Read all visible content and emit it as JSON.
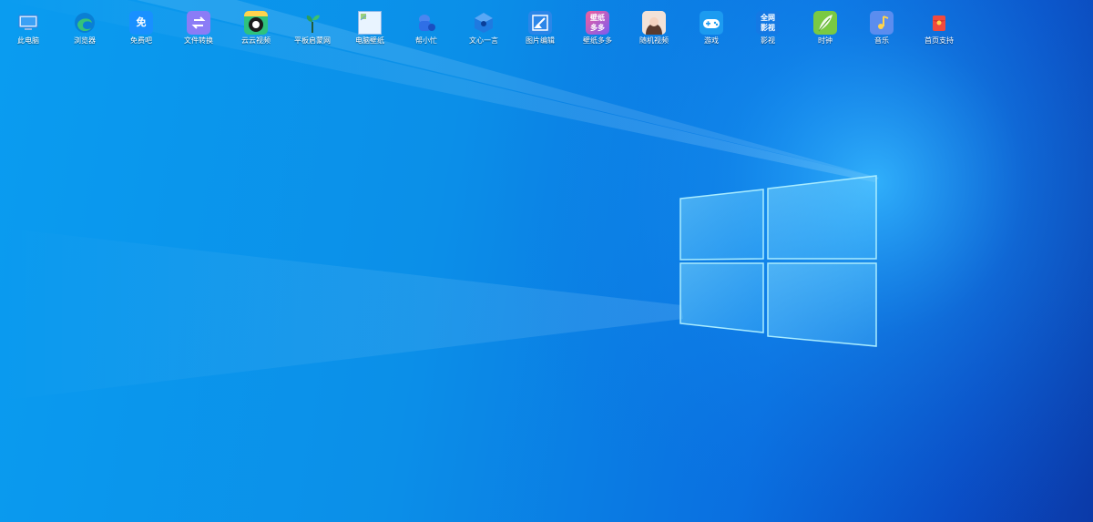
{
  "desktop": {
    "icons": [
      {
        "label": "此电脑",
        "icon": "computer-icon",
        "color": "#1e88e5"
      },
      {
        "label": "浏览器",
        "icon": "edge-browser-icon",
        "color": "#0a7fd4"
      },
      {
        "label": "免费吧",
        "icon": "free-app-icon",
        "color": "#1890ff",
        "glyph_text": "免"
      },
      {
        "label": "文件转换",
        "icon": "file-convert-icon",
        "color": "#8b7cf6"
      },
      {
        "label": "云云视频",
        "icon": "video-icon",
        "color": "#2ec27e"
      },
      {
        "label": "平板启蒙网",
        "icon": "sprout-icon",
        "color": "#2a9d5c"
      },
      {
        "label": "电脑壁纸",
        "icon": "broken-image-icon",
        "color": "#cfe6ff"
      },
      {
        "label": "帮小忙",
        "icon": "helper-icon",
        "color": "#2f6fe6"
      },
      {
        "label": "文心一言",
        "icon": "ernie-cube-icon",
        "color": "#1f7ae0"
      },
      {
        "label": "图片编辑",
        "icon": "image-edit-icon",
        "color": "#2b86e8"
      },
      {
        "label": "壁纸多多",
        "icon": "wallpaper-app-icon",
        "color": "#f2609c",
        "glyph_text": "壁纸多多"
      },
      {
        "label": "随机视频",
        "icon": "portrait-icon",
        "color": "#d9b8a8"
      },
      {
        "label": "游戏",
        "icon": "gamepad-icon",
        "color": "#1c9bf0"
      },
      {
        "label": "影视",
        "icon": "movie-app-icon",
        "color": "#1479e4",
        "glyph_text": "全网影视"
      },
      {
        "label": "时钟",
        "icon": "leaf-clock-icon",
        "color": "#7ac943"
      },
      {
        "label": "音乐",
        "icon": "music-icon",
        "color": "#5b8def"
      },
      {
        "label": "首页支持",
        "icon": "red-packet-icon",
        "color": "#f24a3d"
      }
    ]
  }
}
